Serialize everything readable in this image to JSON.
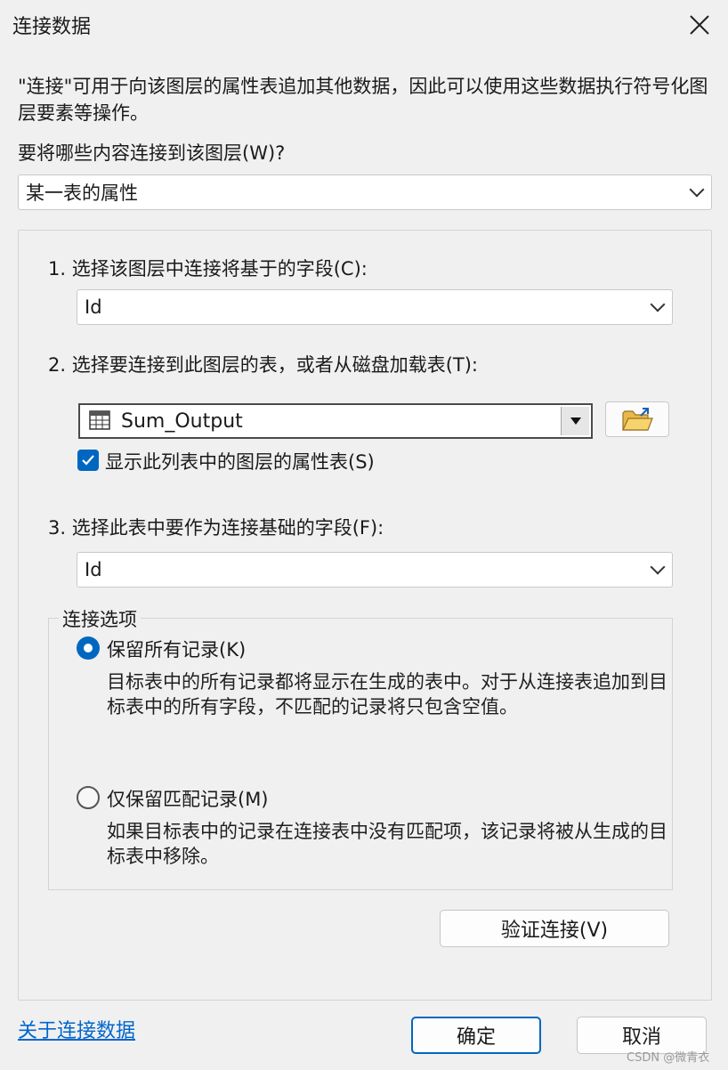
{
  "window": {
    "title": "连接数据"
  },
  "intro_text": "\"连接\"可用于向该图层的属性表追加其他数据，因此可以使用这些数据执行符号化图层要素等操作。",
  "question_label": "要将哪些内容连接到该图层(W)?",
  "join_type": {
    "value": "某一表的属性"
  },
  "step1": {
    "label": "1.  选择该图层中连接将基于的字段(C):",
    "value": "Id"
  },
  "step2": {
    "label": "2.  选择要连接到此图层的表，或者从磁盘加载表(T):",
    "value": "Sum_Output",
    "show_layers_label": "显示此列表中的图层的属性表(S)",
    "show_layers_checked": true
  },
  "step3": {
    "label": "3.  选择此表中要作为连接基础的字段(F):",
    "value": "Id"
  },
  "join_options": {
    "legend": "连接选项",
    "keep_all": {
      "label": "保留所有记录(K)",
      "selected": true,
      "description": "目标表中的所有记录都将显示在生成的表中。对于从连接表追加到目标表中的所有字段，不匹配的记录将只包含空值。"
    },
    "keep_matching": {
      "label": "仅保留匹配记录(M)",
      "selected": false,
      "description": "如果目标表中的记录在连接表中没有匹配项，该记录将被从生成的目标表中移除。"
    }
  },
  "buttons": {
    "validate": "验证连接(V)",
    "ok": "确定",
    "cancel": "取消"
  },
  "help_link": "关于连接数据",
  "watermark": "CSDN @微青衣",
  "colors": {
    "accent": "#0067c0",
    "link": "#0066cc"
  },
  "icons": [
    "close-icon",
    "chevron-down-icon",
    "table-icon",
    "folder-open-icon",
    "checkmark-icon"
  ]
}
